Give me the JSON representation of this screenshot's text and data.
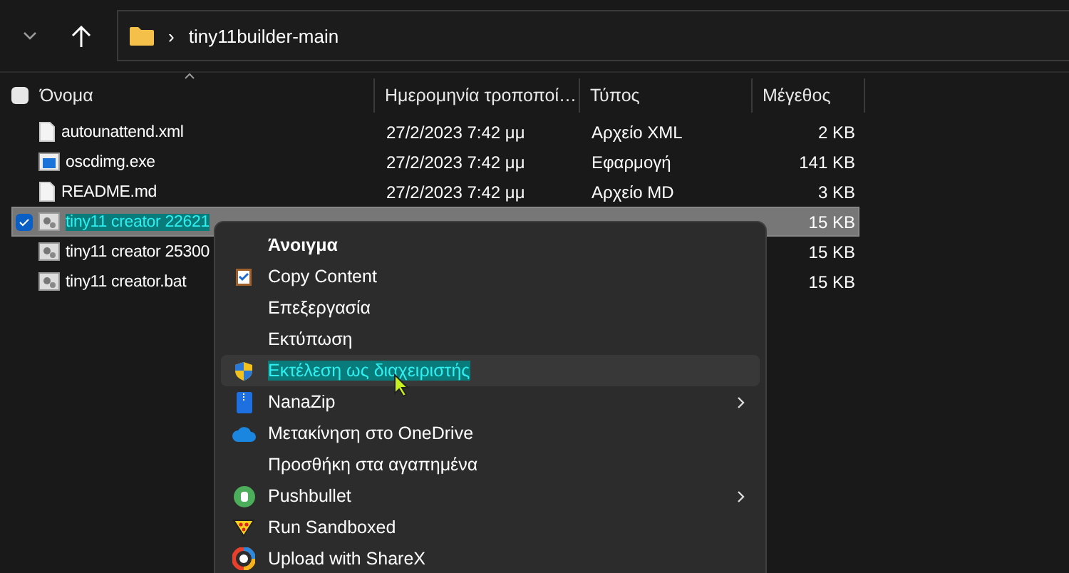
{
  "address_bar": {
    "path": "tiny11builder-main",
    "separator": "›"
  },
  "table": {
    "select_all": {
      "checked": false
    },
    "columns": [
      "Όνομα",
      "Ημερομηνία τροποποί…",
      "Τύπος",
      "Μέγεθος"
    ],
    "rows": [
      {
        "name": "autounattend.xml",
        "kind": "document",
        "date": "27/2/2023 7:42 μμ",
        "type": "Αρχείο XML",
        "size": "2 KB",
        "selected": false
      },
      {
        "name": "oscdimg.exe",
        "kind": "application",
        "date": "27/2/2023 7:42 μμ",
        "type": "Εφαρμογή",
        "size": "141 KB",
        "selected": false
      },
      {
        "name": "README.md",
        "kind": "document",
        "date": "27/2/2023 7:42 μμ",
        "type": "Αρχείο MD",
        "size": "3 KB",
        "selected": false
      },
      {
        "name": "tiny11 creator 22621",
        "kind": "batch",
        "size": "15 KB",
        "selected": true
      },
      {
        "name": "tiny11 creator 25300",
        "kind": "batch",
        "size": "15 KB",
        "selected": false
      },
      {
        "name": "tiny11 creator.bat",
        "kind": "batch",
        "size": "15 KB",
        "selected": false
      }
    ]
  },
  "context_menu": {
    "items": [
      {
        "label": "Άνοιγμα",
        "default": true,
        "hovered": false,
        "submenu": false
      },
      {
        "label": "Copy Content",
        "default": false,
        "hovered": false,
        "submenu": false
      },
      {
        "label": "Επεξεργασία",
        "default": false,
        "hovered": false,
        "submenu": false
      },
      {
        "label": "Εκτύπωση",
        "default": false,
        "hovered": false,
        "submenu": false
      },
      {
        "label": "Εκτέλεση ως διαχειριστής",
        "default": false,
        "hovered": true,
        "submenu": false
      },
      {
        "label": "NanaZip",
        "default": false,
        "hovered": false,
        "submenu": true
      },
      {
        "label": "Μετακίνηση στο OneDrive",
        "default": false,
        "hovered": false,
        "submenu": false
      },
      {
        "label": "Προσθήκη στα αγαπημένα",
        "default": false,
        "hovered": false,
        "submenu": false
      },
      {
        "label": "Pushbullet",
        "default": false,
        "hovered": false,
        "submenu": true
      },
      {
        "label": "Run Sandboxed",
        "default": false,
        "hovered": false,
        "submenu": false
      },
      {
        "label": "Upload with ShareX",
        "default": false,
        "hovered": false,
        "submenu": false
      }
    ]
  }
}
